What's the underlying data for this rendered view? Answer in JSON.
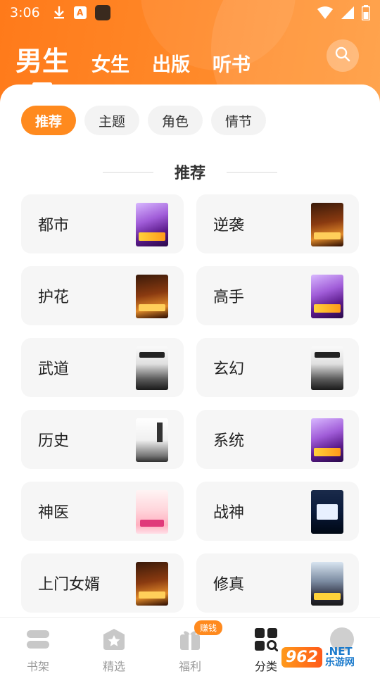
{
  "status_bar": {
    "time": "3:06"
  },
  "header": {
    "tabs": [
      {
        "label": "男生",
        "active": true
      },
      {
        "label": "女生",
        "active": false
      },
      {
        "label": "出版",
        "active": false
      },
      {
        "label": "听书",
        "active": false
      }
    ],
    "search_icon": "search-icon"
  },
  "filter_chips": [
    {
      "label": "推荐",
      "active": true
    },
    {
      "label": "主题",
      "active": false
    },
    {
      "label": "角色",
      "active": false
    },
    {
      "label": "情节",
      "active": false
    }
  ],
  "section": {
    "title": "推荐"
  },
  "categories": [
    {
      "label": "都市"
    },
    {
      "label": "逆袭"
    },
    {
      "label": "护花"
    },
    {
      "label": "高手"
    },
    {
      "label": "武道"
    },
    {
      "label": "玄幻"
    },
    {
      "label": "历史"
    },
    {
      "label": "系统"
    },
    {
      "label": "神医"
    },
    {
      "label": "战神"
    },
    {
      "label": "上门女婿"
    },
    {
      "label": "修真"
    }
  ],
  "bottom_nav": {
    "items": [
      {
        "label": "书架",
        "icon": "bookshelf-icon",
        "active": false
      },
      {
        "label": "精选",
        "icon": "star-icon",
        "active": false
      },
      {
        "label": "福利",
        "icon": "gift-icon",
        "active": false,
        "badge": "赚钱"
      },
      {
        "label": "分类",
        "icon": "category-icon",
        "active": true
      },
      {
        "label": "",
        "icon": "avatar-icon",
        "active": false
      }
    ]
  },
  "watermark": {
    "logo": "962",
    "suffix": ".NET",
    "subtitle": "乐游网"
  },
  "colors": {
    "accent": "#ff8a1e",
    "header_gradient_start": "#ff7a1a",
    "header_gradient_end": "#ff9a3a",
    "card_bg": "#f6f6f6"
  }
}
